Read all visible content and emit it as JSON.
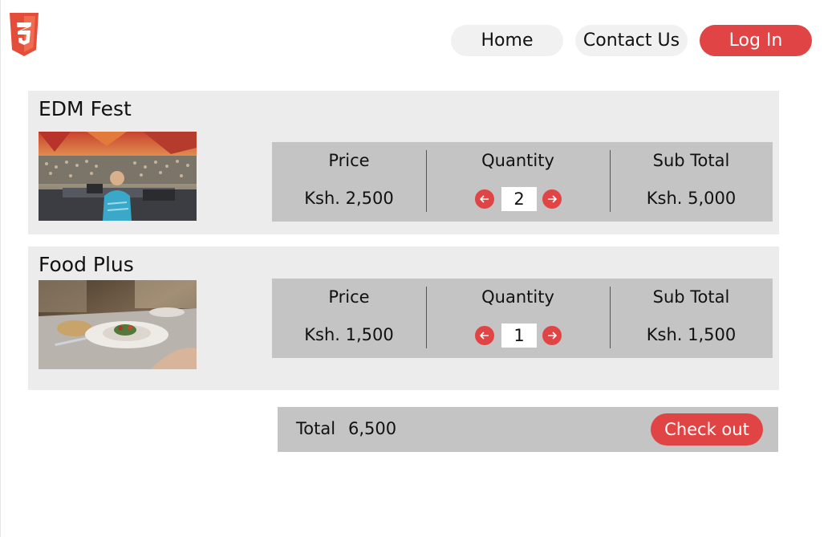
{
  "nav": {
    "home_label": "Home",
    "contact_label": "Contact Us",
    "login_label": "Log In"
  },
  "logo": {
    "icon": "css3-logo-icon",
    "color": "#e44d3a"
  },
  "items": [
    {
      "title": "EDM Fest",
      "image": "concert-photo",
      "price_label": "Price",
      "price": "Ksh. 2,500",
      "quantity_label": "Quantity",
      "quantity": "2",
      "subtotal_label": "Sub Total",
      "subtotal": "Ksh. 5,000"
    },
    {
      "title": "Food Plus",
      "image": "restaurant-plate-photo",
      "price_label": "Price",
      "price": "Ksh. 1,500",
      "quantity_label": "Quantity",
      "quantity": "1",
      "subtotal_label": "Sub Total",
      "subtotal": "Ksh. 1,500"
    }
  ],
  "summary": {
    "total_label": "Total",
    "total_value": "6,500",
    "checkout_label": "Check out"
  },
  "colors": {
    "accent": "#e04444",
    "panel": "#c4c4c4",
    "card": "#ececec",
    "nav_bg": "#f1f1f1"
  },
  "icons": {
    "decrement": "arrow-left-icon",
    "increment": "arrow-right-icon"
  }
}
